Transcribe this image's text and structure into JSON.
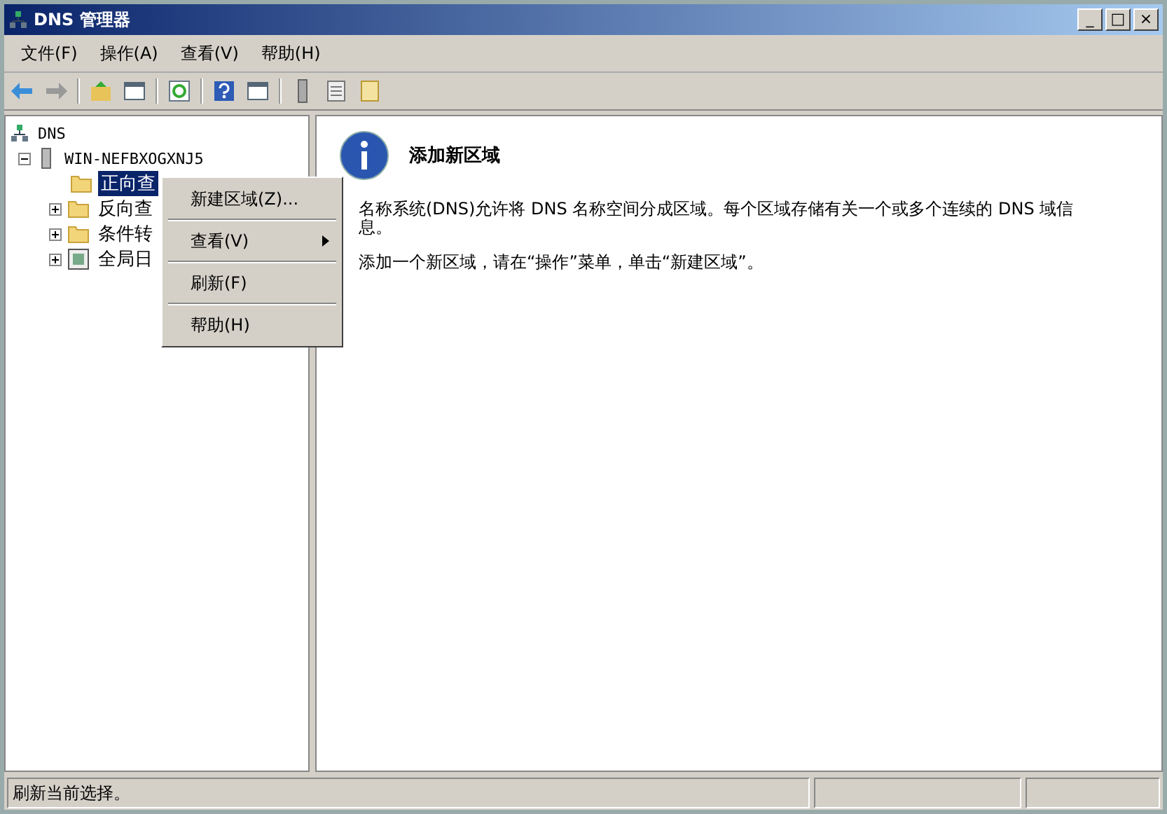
{
  "window": {
    "title": "DNS 管理器",
    "controls": [
      "_",
      "□",
      "×"
    ]
  },
  "menu": [
    "文件(F)",
    "操作(A)",
    "查看(V)",
    "帮助(H)"
  ],
  "toolbar": [
    {
      "kind": "back"
    },
    {
      "kind": "forward"
    },
    {
      "kind": "folder-up"
    },
    {
      "kind": "pane"
    },
    {
      "kind": "refresh"
    },
    {
      "kind": "help"
    },
    {
      "kind": "pane"
    },
    {
      "kind": "server"
    },
    {
      "kind": "list"
    },
    {
      "kind": "doc"
    }
  ],
  "tree": [
    {
      "label": "DNS",
      "kind": "dns",
      "children": [
        {
          "label": "WIN-NEFBXOGXNJ5",
          "kind": "server",
          "expanded": true,
          "children": [
            {
              "label": "正向查",
              "kind": "folder",
              "selected": true
            },
            {
              "label": "反向查",
              "kind": "folder",
              "selected": false,
              "expanded": false
            },
            {
              "label": "条件转",
              "kind": "folder",
              "selected": false,
              "expanded": false
            },
            {
              "label": "全局日",
              "kind": "log",
              "selected": false,
              "expanded": false
            }
          ]
        }
      ]
    }
  ],
  "context_menu": [
    {
      "label": "新建区域(Z)...",
      "submenu": false
    },
    {
      "label": "查看(V)",
      "submenu": true
    },
    {
      "label": "刷新(F)",
      "submenu": false
    },
    {
      "label": "帮助(H)",
      "submenu": false
    }
  ],
  "content": {
    "heading": "添加新区域",
    "paragraphs": [
      "名称系统(DNS)允许将 DNS 名称空间分成区域。每个区域存储有关一个或多个连续的 DNS 域信息。",
      "添加一个新区域，请在“操作”菜单，单击“新建区域”。"
    ]
  },
  "status_bar": [
    "刷新当前选择。"
  ]
}
